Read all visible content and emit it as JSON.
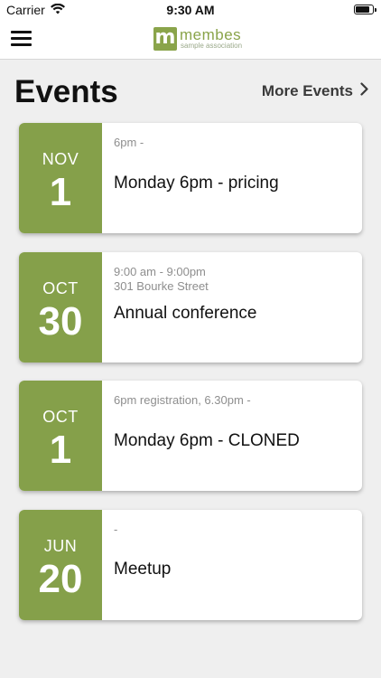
{
  "status_bar": {
    "carrier": "Carrier",
    "time": "9:30 AM"
  },
  "nav": {
    "logo_letter": "m",
    "logo_name": "membes",
    "logo_tagline": "sample association",
    "brand_color": "#8aa44a"
  },
  "header": {
    "title": "Events",
    "more_label": "More Events"
  },
  "events": [
    {
      "month": "NOV",
      "day": "1",
      "meta": "6pm -",
      "title": "Monday 6pm - pricing"
    },
    {
      "month": "OCT",
      "day": "30",
      "meta": "9:00 am - 9:00pm\n301 Bourke Street",
      "title": "Annual conference"
    },
    {
      "month": "OCT",
      "day": "1",
      "meta": "6pm registration, 6.30pm -",
      "title": "Monday 6pm - CLONED"
    },
    {
      "month": "JUN",
      "day": "20",
      "meta": " -",
      "title": "Meetup"
    }
  ]
}
